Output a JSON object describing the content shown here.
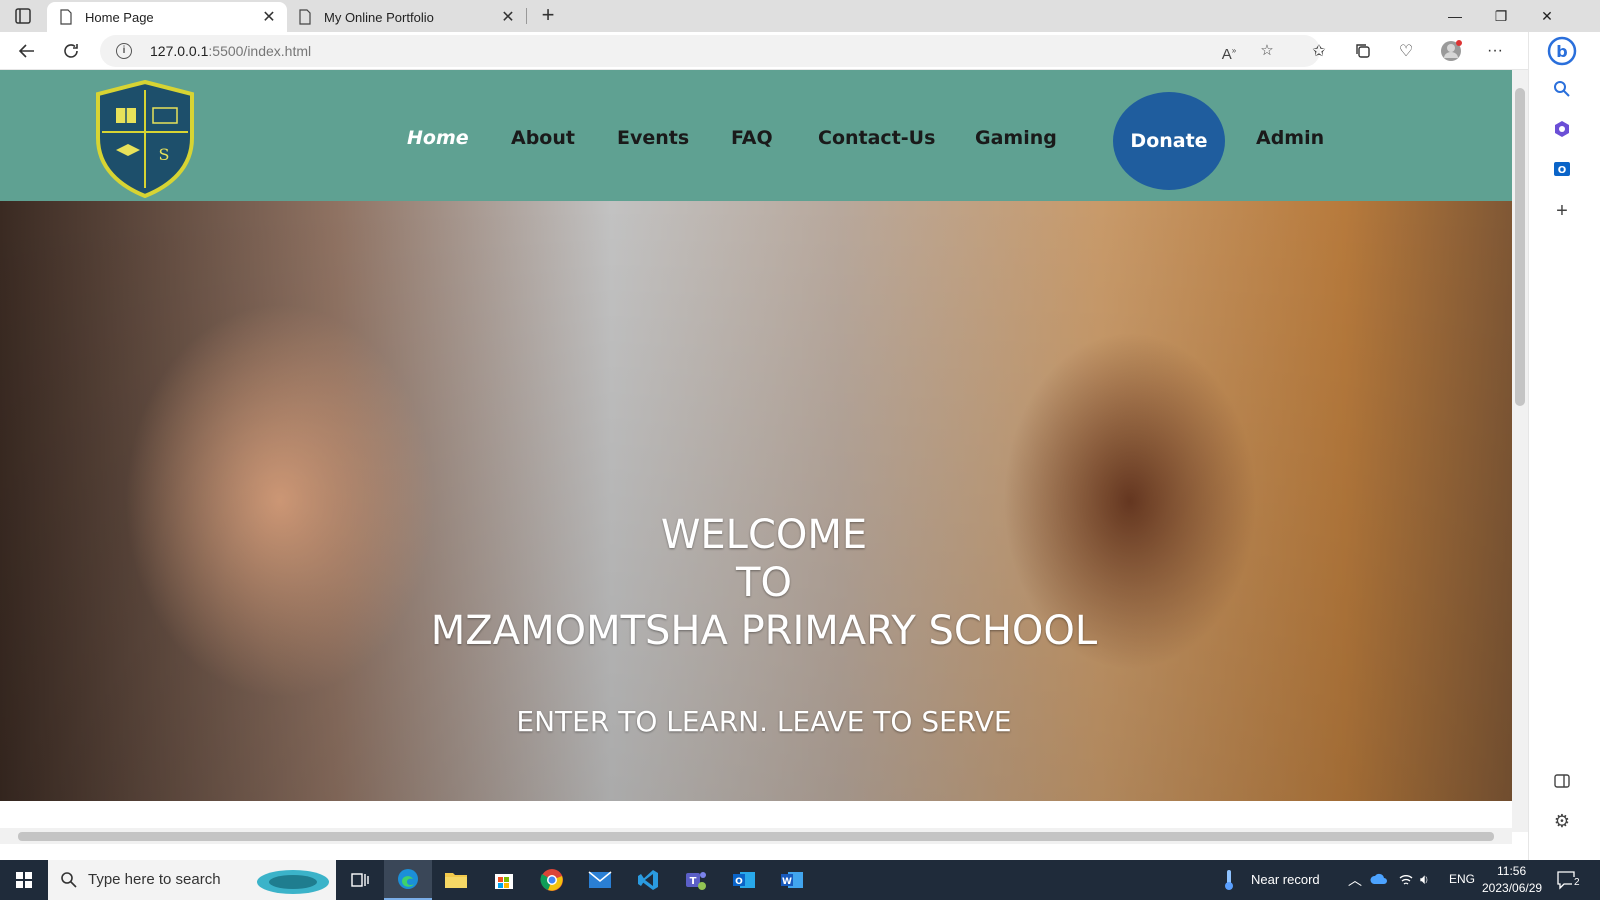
{
  "browser": {
    "tabs": [
      {
        "title": "Home Page",
        "active": true
      },
      {
        "title": "My Online Portfolio",
        "active": false
      }
    ],
    "url_host": "127.0.0.1",
    "url_path": ":5500/index.html"
  },
  "site": {
    "nav": [
      {
        "label": "Home",
        "active": true
      },
      {
        "label": "About"
      },
      {
        "label": "Events"
      },
      {
        "label": "FAQ"
      },
      {
        "label": "Contact-Us"
      },
      {
        "label": "Gaming"
      }
    ],
    "donate_label": "Donate",
    "admin_label": "Admin",
    "hero": {
      "line1": "WELCOME",
      "line2": "TO",
      "line3": "MZAMOMTSHA PRIMARY SCHOOL",
      "tagline": "ENTER TO LEARN. LEAVE TO SERVE"
    },
    "logo_letter": "S"
  },
  "taskbar": {
    "search_placeholder": "Type here to search",
    "weather_text": "Near record",
    "lang": "ENG",
    "time": "11:56",
    "date": "2023/06/29",
    "notification_count": "2"
  },
  "colors": {
    "header_bg": "#5fa192",
    "donate_bg": "#1f5d9e",
    "logo_shield": "#1d4f6b",
    "logo_border": "#d7d433"
  }
}
